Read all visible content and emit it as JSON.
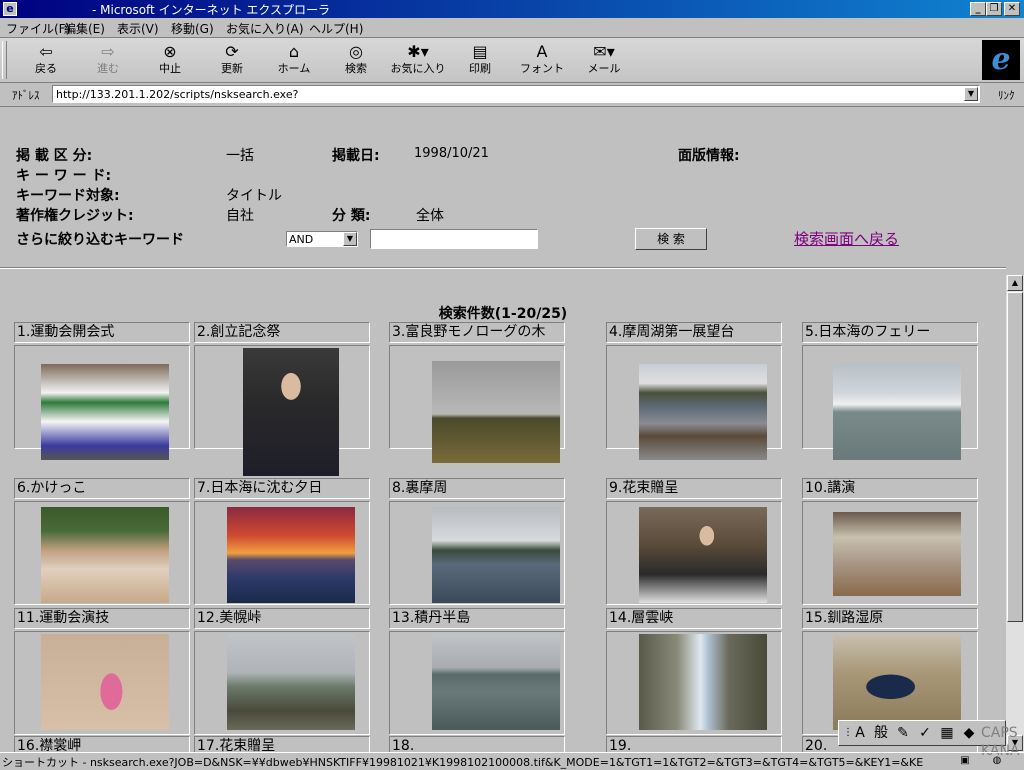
{
  "window": {
    "title": "- Microsoft インターネット エクスプローラ",
    "icon": "ie-icon",
    "minimize": "_",
    "restore": "❐",
    "close": "✕"
  },
  "menu": [
    "ファイル(F)",
    "編集(E)",
    "表示(V)",
    "移動(G)",
    "お気に入り(A)",
    "ヘルプ(H)"
  ],
  "toolbar": {
    "back": {
      "label": "戻る",
      "icon": "back-arrow-icon"
    },
    "forward": {
      "label": "進む",
      "icon": "forward-arrow-icon"
    },
    "stop": {
      "label": "中止",
      "icon": "stop-icon"
    },
    "refresh": {
      "label": "更新",
      "icon": "refresh-icon"
    },
    "home": {
      "label": "ホーム",
      "icon": "home-icon"
    },
    "search": {
      "label": "検索",
      "icon": "search-icon"
    },
    "favorites": {
      "label": "お気に入り",
      "icon": "favorites-icon"
    },
    "print": {
      "label": "印刷",
      "icon": "print-icon"
    },
    "font": {
      "label": "フォント",
      "icon": "font-icon"
    },
    "mail": {
      "label": "メール",
      "icon": "mail-icon"
    }
  },
  "address": {
    "label": "ｱﾄﾞﾚｽ",
    "url": "http://133.201.1.202/scripts/nsksearch.exe?",
    "links_label": "ﾘﾝｸ"
  },
  "form": {
    "category_label": "掲 載 区 分:",
    "category_value": "一括",
    "date_label": "掲載日:",
    "date_value": "1998/10/21",
    "edition_label": "面版情報:",
    "keyword_label": "キ ー ワ ー ド:",
    "keyword_target_label": "キーワード対象:",
    "keyword_target_value": "タイトル",
    "copyright_label": "著作権クレジット:",
    "copyright_value": "自社",
    "class_label": "分 類:",
    "class_value": "全体",
    "refine_label": "さらに絞り込むキーワード",
    "operator_value": "AND",
    "refine_input_value": "",
    "search_button": "検 索",
    "back_link": "検索画面へ戻る"
  },
  "results": {
    "count_label": "検索件数(1-20/25)",
    "items": [
      {
        "caption": "1.運動会開会式"
      },
      {
        "caption": "2.創立記念祭"
      },
      {
        "caption": "3.富良野モノローグの木"
      },
      {
        "caption": "4.摩周湖第一展望台"
      },
      {
        "caption": "5.日本海のフェリー"
      },
      {
        "caption": "6.かけっこ"
      },
      {
        "caption": "7.日本海に沈む夕日"
      },
      {
        "caption": "8.裏摩周"
      },
      {
        "caption": "9.花束贈呈"
      },
      {
        "caption": "10.講演"
      },
      {
        "caption": "11.運動会演技"
      },
      {
        "caption": "12.美幌峠"
      },
      {
        "caption": "13.積丹半島"
      },
      {
        "caption": "14.層雲峡"
      },
      {
        "caption": "15.釧路湿原"
      },
      {
        "caption": "16.襟裳岬"
      },
      {
        "caption": "17.花束贈呈"
      },
      {
        "caption": "18."
      },
      {
        "caption": "19."
      },
      {
        "caption": "20."
      }
    ]
  },
  "ime": {
    "mode": "A",
    "dict": "般",
    "caps": "CAPS",
    "kana": "KANA"
  },
  "status": {
    "text": "ショートカット - nsksearch.exe?JOB=D&NSK=¥¥dbweb¥HNSKTIFF¥19981021¥K1998102100008.tif&K_MODE=1&TGT1=1&TGT2=&TGT3=&TGT4=&TGT5=&KEY1=&KE"
  }
}
